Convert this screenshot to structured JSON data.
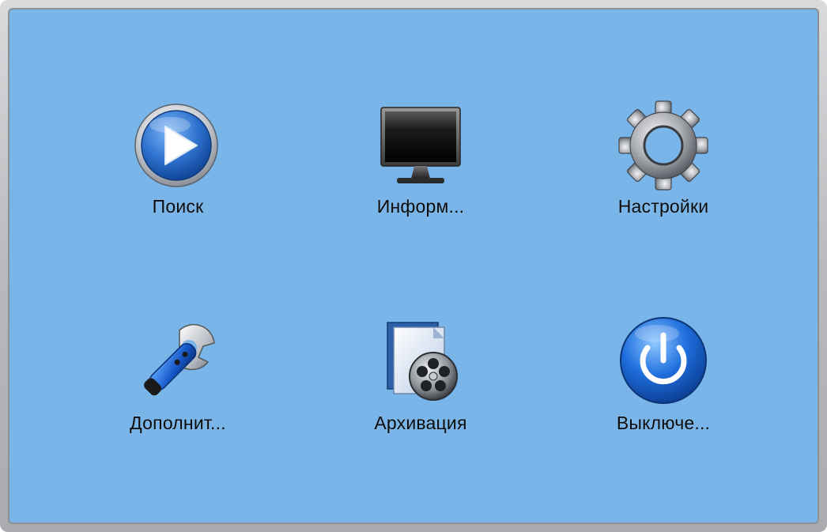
{
  "menu": {
    "items": [
      {
        "label": "Поиск",
        "icon": "play-icon"
      },
      {
        "label": "Информ...",
        "icon": "monitor-icon"
      },
      {
        "label": "Настройки",
        "icon": "gear-icon"
      },
      {
        "label": "Дополнит...",
        "icon": "wrench-icon"
      },
      {
        "label": "Архивация",
        "icon": "film-reel-icon"
      },
      {
        "label": "Выключе...",
        "icon": "power-icon"
      }
    ]
  },
  "colors": {
    "panel_background": "#79b5e8",
    "frame": "#b8babd",
    "label_text": "#0a0a0a"
  }
}
